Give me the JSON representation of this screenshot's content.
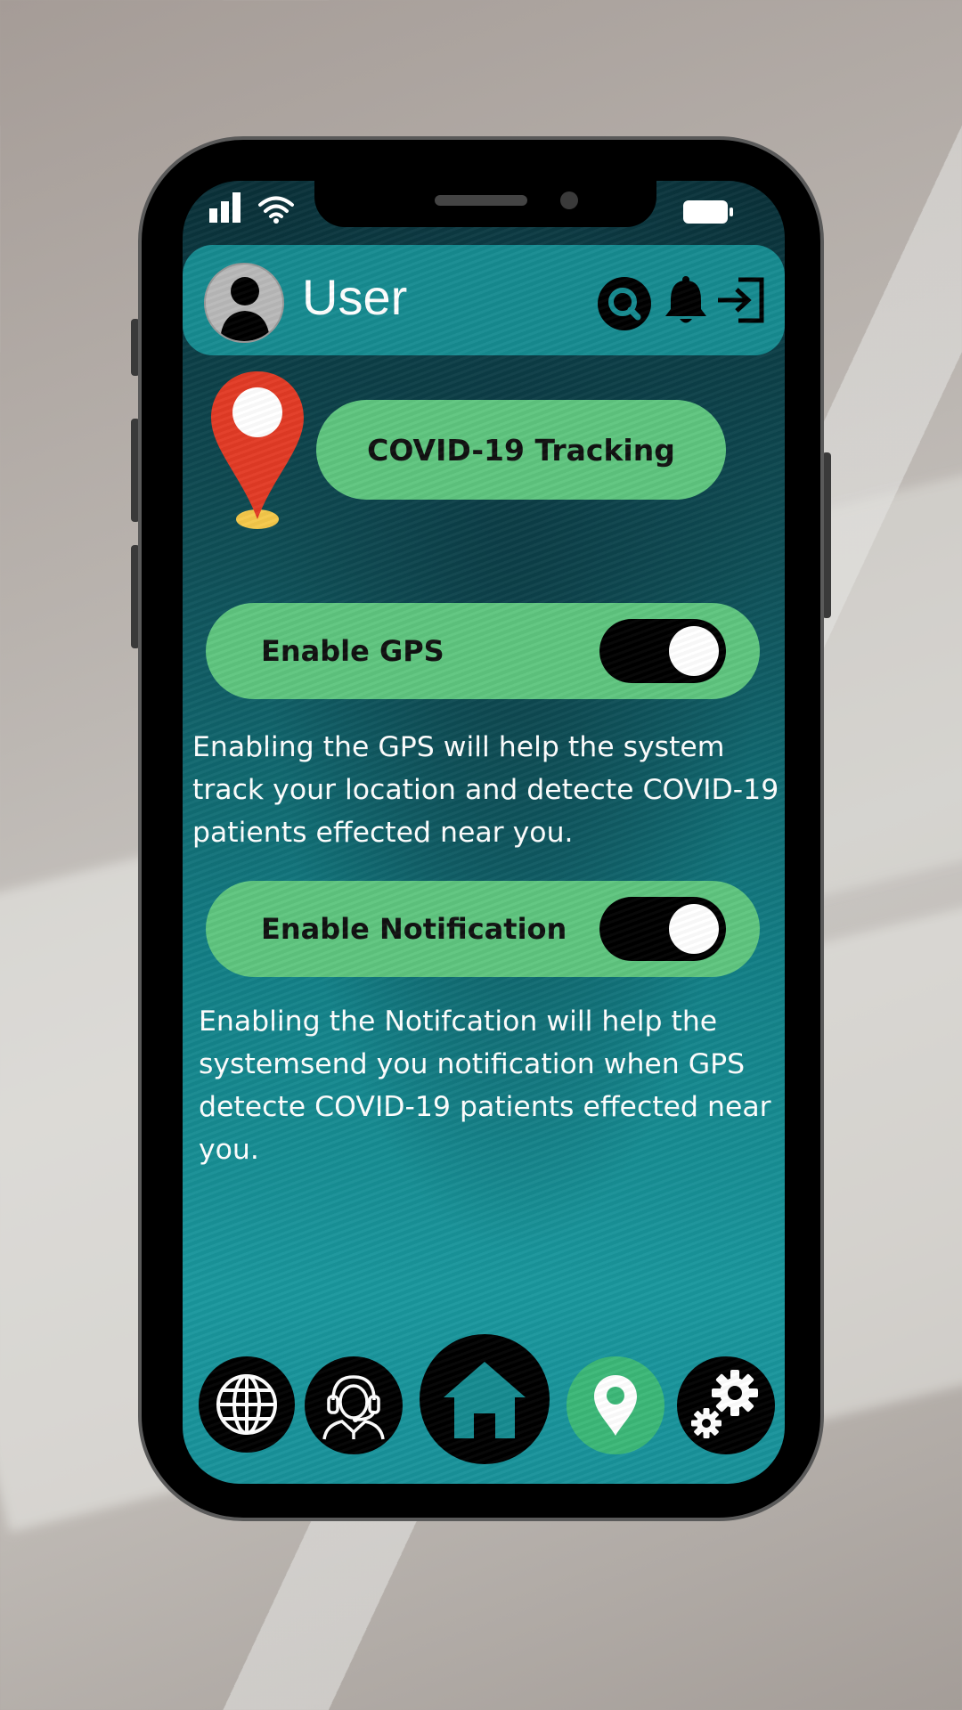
{
  "header": {
    "user_name": "User"
  },
  "tracking": {
    "button_label": "COVID-19 Tracking"
  },
  "gps": {
    "label": "Enable GPS",
    "enabled": true,
    "description": "Enabling the GPS will help the system track your location and detecte COVID-19 patients effected near you."
  },
  "notification": {
    "label": "Enable Notification",
    "enabled": true,
    "description": "Enabling the Notifcation will help the systemsend you notification when GPS detecte COVID-19 patients effected near you."
  },
  "nav": {
    "items": [
      "globe-icon",
      "support-agent-icon",
      "home-icon",
      "location-pin-icon",
      "settings-gears-icon"
    ],
    "active": "location-pin-icon"
  },
  "colors": {
    "accent_green": "#5fc57f",
    "active_nav_green": "#3cb878",
    "header_teal": "#178b91",
    "pin_red": "#e23b25",
    "pin_base_yellow": "#f5c84a"
  }
}
